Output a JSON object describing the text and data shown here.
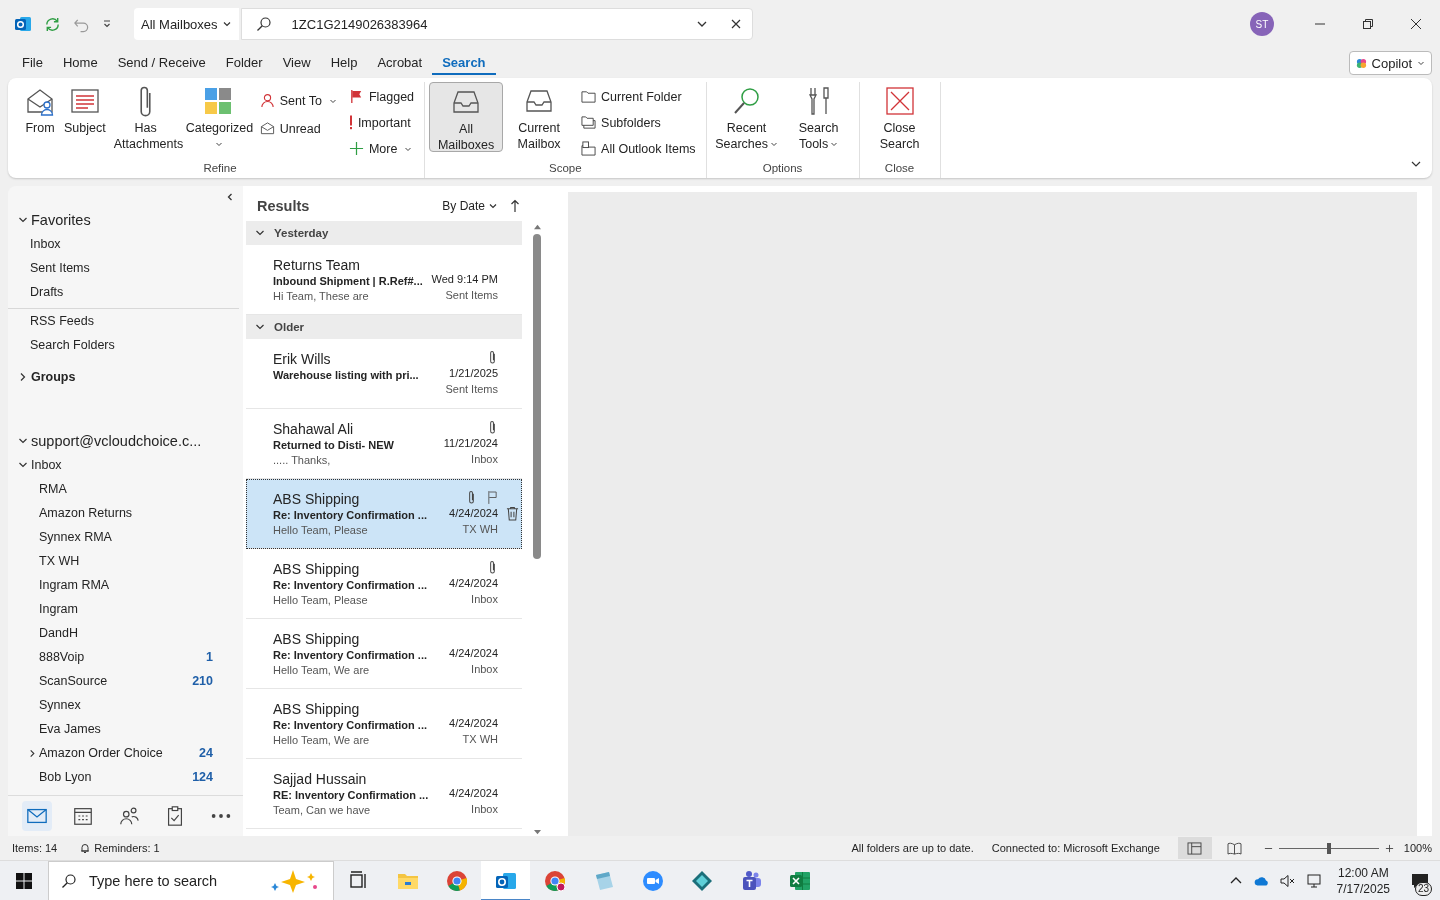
{
  "title_bar": {
    "scope": "All Mailboxes",
    "search_value": "1ZC1G2149026383964",
    "avatar": "ST"
  },
  "menu_tabs": [
    {
      "label": "File",
      "selected": false
    },
    {
      "label": "Home",
      "selected": false
    },
    {
      "label": "Send / Receive",
      "selected": false
    },
    {
      "label": "Folder",
      "selected": false
    },
    {
      "label": "View",
      "selected": false
    },
    {
      "label": "Help",
      "selected": false
    },
    {
      "label": "Acrobat",
      "selected": false
    },
    {
      "label": "Search",
      "selected": true
    }
  ],
  "copilot": "Copilot",
  "ribbon": {
    "groups": [
      {
        "label": "Refine",
        "items": [
          {
            "kind": "large",
            "label": "From"
          },
          {
            "kind": "large",
            "label": "Subject"
          },
          {
            "kind": "large",
            "label": "Has Attachments"
          },
          {
            "kind": "large",
            "label": "Categorized",
            "dropdown": true
          },
          {
            "kind": "stack",
            "items": [
              {
                "label": "Sent To",
                "dropdown": true
              },
              {
                "label": "Unread"
              }
            ]
          },
          {
            "kind": "stack",
            "items": [
              {
                "label": "Flagged"
              },
              {
                "label": "Important"
              },
              {
                "label": "More",
                "dropdown": true
              }
            ]
          }
        ]
      },
      {
        "label": "Scope",
        "items": [
          {
            "kind": "large",
            "label": "All Mailboxes",
            "selected": true
          },
          {
            "kind": "large",
            "label": "Current Mailbox",
            "selected": false
          },
          {
            "kind": "stack",
            "items": [
              {
                "label": "Current Folder"
              },
              {
                "label": "Subfolders"
              },
              {
                "label": "All Outlook Items"
              }
            ]
          }
        ]
      },
      {
        "label": "Options",
        "items": [
          {
            "kind": "large",
            "label": "Recent Searches",
            "dropdown": true
          },
          {
            "kind": "large",
            "label": "Search Tools",
            "dropdown": true
          }
        ]
      },
      {
        "label": "Close",
        "items": [
          {
            "kind": "large",
            "label": "Close Search"
          }
        ]
      }
    ]
  },
  "nav": {
    "favorites": {
      "label": "Favorites",
      "expanded": true,
      "items": [
        {
          "label": "Inbox"
        },
        {
          "label": "Sent Items"
        },
        {
          "label": "Drafts"
        }
      ]
    },
    "folders": [
      {
        "label": "RSS Feeds"
      },
      {
        "label": "Search Folders"
      }
    ],
    "groups": {
      "label": "Groups",
      "expanded": false
    },
    "account": {
      "label": "support@vcloudchoice.c...",
      "expanded": true,
      "children": [
        {
          "label": "Inbox",
          "expanded": true,
          "children": [
            {
              "label": "RMA"
            },
            {
              "label": "Amazon Returns"
            },
            {
              "label": "Synnex RMA"
            },
            {
              "label": "TX WH"
            },
            {
              "label": "Ingram RMA"
            },
            {
              "label": "Ingram"
            },
            {
              "label": "DandH"
            },
            {
              "label": "888Voip",
              "count": "1"
            },
            {
              "label": "ScanSource",
              "count": "210"
            },
            {
              "label": "Synnex"
            },
            {
              "label": "Eva James"
            },
            {
              "label": "Amazon Order Choice",
              "expanded": false,
              "count": "24"
            },
            {
              "label": "Bob Lyon",
              "count": "124"
            }
          ]
        }
      ]
    },
    "modules": [
      {
        "selected": true
      },
      {
        "selected": false
      },
      {
        "selected": false
      },
      {
        "selected": false
      },
      {
        "selected": false
      }
    ]
  },
  "results": {
    "title": "Results",
    "sort": "By Date",
    "groups": [
      {
        "label": "Yesterday",
        "expanded": true,
        "messages": [
          {
            "sender": "Returns Team",
            "subject": "Inbound Shipment | R.Ref#...",
            "preview": "Hi Team,  These are",
            "date": "Wed 9:14 PM",
            "folder": "Sent Items",
            "attachment": false,
            "selected": false
          }
        ]
      },
      {
        "label": "Older",
        "expanded": true,
        "messages": [
          {
            "sender": "Erik Wills",
            "subject": "Warehouse listing with pri...",
            "date": "1/21/2025",
            "folder": "Sent Items",
            "attachment": true,
            "selected": false
          },
          {
            "sender": "Shahawal Ali",
            "subject": "Returned to Disti- NEW",
            "preview": ".....  Thanks,",
            "date": "11/21/2024",
            "folder": "Inbox",
            "attachment": true,
            "selected": false
          },
          {
            "sender": "ABS Shipping",
            "subject": "Re: Inventory Confirmation ...",
            "preview": "Hello Team,  Please",
            "date": "4/24/2024",
            "folder": "TX WH",
            "attachment": true,
            "selected": true
          },
          {
            "sender": "ABS Shipping",
            "subject": "Re: Inventory Confirmation ...",
            "preview": "Hello Team,  Please",
            "date": "4/24/2024",
            "folder": "Inbox",
            "attachment": true,
            "selected": false
          },
          {
            "sender": "ABS Shipping",
            "subject": "Re: Inventory Confirmation ...",
            "preview": "Hello Team,  We are",
            "date": "4/24/2024",
            "folder": "Inbox",
            "attachment": false,
            "selected": false
          },
          {
            "sender": "ABS Shipping",
            "subject": "Re: Inventory Confirmation ...",
            "preview": "Hello Team,  We are",
            "date": "4/24/2024",
            "folder": "TX WH",
            "attachment": false,
            "selected": false
          },
          {
            "sender": "Sajjad Hussain",
            "subject": "RE: Inventory Confirmation ...",
            "preview": "Team, Can we have",
            "date": "4/24/2024",
            "folder": "Inbox",
            "attachment": false,
            "selected": false
          }
        ]
      }
    ]
  },
  "status_bar": {
    "items": "Items: 14",
    "reminders": "Reminders: 1",
    "sync": "All folders are up to date.",
    "connection": "Connected to: Microsoft Exchange",
    "views": [
      {
        "selected": true
      },
      {
        "selected": false
      }
    ],
    "zoom": {
      "level": 0.5,
      "reading": "100%"
    }
  },
  "taskbar": {
    "search_placeholder": "Type here to search",
    "apps": [
      {
        "active": false
      },
      {
        "active": false
      },
      {
        "active": false
      },
      {
        "active": true
      },
      {
        "active": false
      },
      {
        "active": false
      },
      {
        "active": false
      },
      {
        "active": false
      },
      {
        "active": false
      },
      {
        "active": false
      }
    ],
    "time": "12:00 AM",
    "date": "7/17/2025",
    "notifications": "23"
  }
}
